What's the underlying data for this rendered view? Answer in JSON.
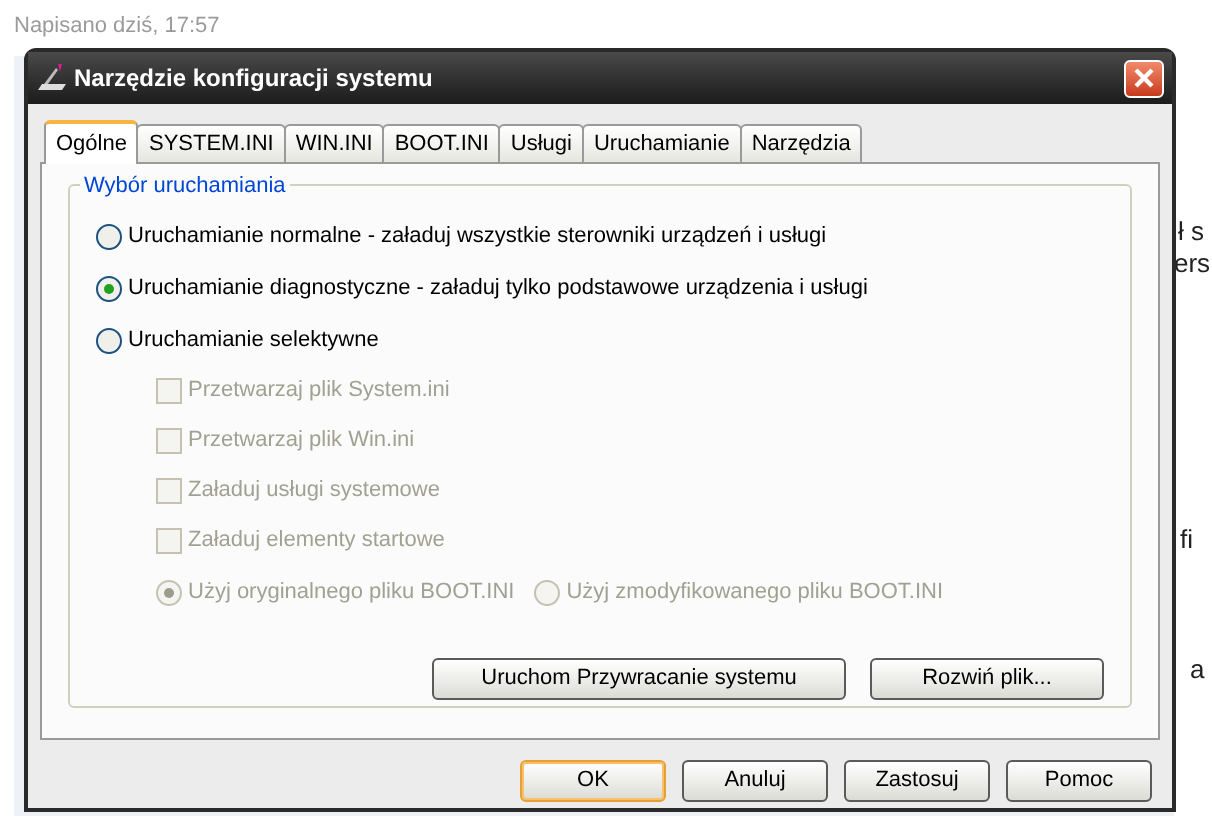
{
  "post": {
    "meta": "Napisano dziś, 17:57",
    "fragments": [
      "ł s",
      "ers",
      "fi",
      "a"
    ]
  },
  "window": {
    "title": "Narzędzie konfiguracji systemu"
  },
  "tabs": [
    {
      "label": "Ogólne",
      "selected": true
    },
    {
      "label": "SYSTEM.INI",
      "selected": false
    },
    {
      "label": "WIN.INI",
      "selected": false
    },
    {
      "label": "BOOT.INI",
      "selected": false
    },
    {
      "label": "Usługi",
      "selected": false
    },
    {
      "label": "Uruchamianie",
      "selected": false
    },
    {
      "label": "Narzędzia",
      "selected": false
    }
  ],
  "group": {
    "title": "Wybór uruchamiania",
    "modes": [
      {
        "label": "Uruchamianie normalne - załaduj wszystkie sterowniki urządzeń i usługi",
        "selected": false
      },
      {
        "label": "Uruchamianie diagnostyczne - załaduj tylko podstawowe urządzenia i usługi",
        "selected": true
      },
      {
        "label": "Uruchamianie selektywne",
        "selected": false
      }
    ],
    "options": [
      {
        "label": "Przetwarzaj plik System.ini",
        "checked": false,
        "disabled": true
      },
      {
        "label": "Przetwarzaj plik Win.ini",
        "checked": false,
        "disabled": true
      },
      {
        "label": "Załaduj usługi systemowe",
        "checked": false,
        "disabled": true
      },
      {
        "label": "Załaduj elementy startowe",
        "checked": false,
        "disabled": true
      }
    ],
    "boot_choices": [
      {
        "label": "Użyj oryginalnego pliku BOOT.INI",
        "selected": true,
        "disabled": true
      },
      {
        "label": "Użyj zmodyfikowanego pliku BOOT.INI",
        "selected": false,
        "disabled": true
      }
    ],
    "buttons": [
      "Uruchom Przywracanie systemu",
      "Rozwiń plik..."
    ]
  },
  "buttons": [
    {
      "label": "OK",
      "default": true
    },
    {
      "label": "Anuluj",
      "default": false
    },
    {
      "label": "Zastosuj",
      "default": false
    },
    {
      "label": "Pomoc",
      "default": false
    }
  ]
}
